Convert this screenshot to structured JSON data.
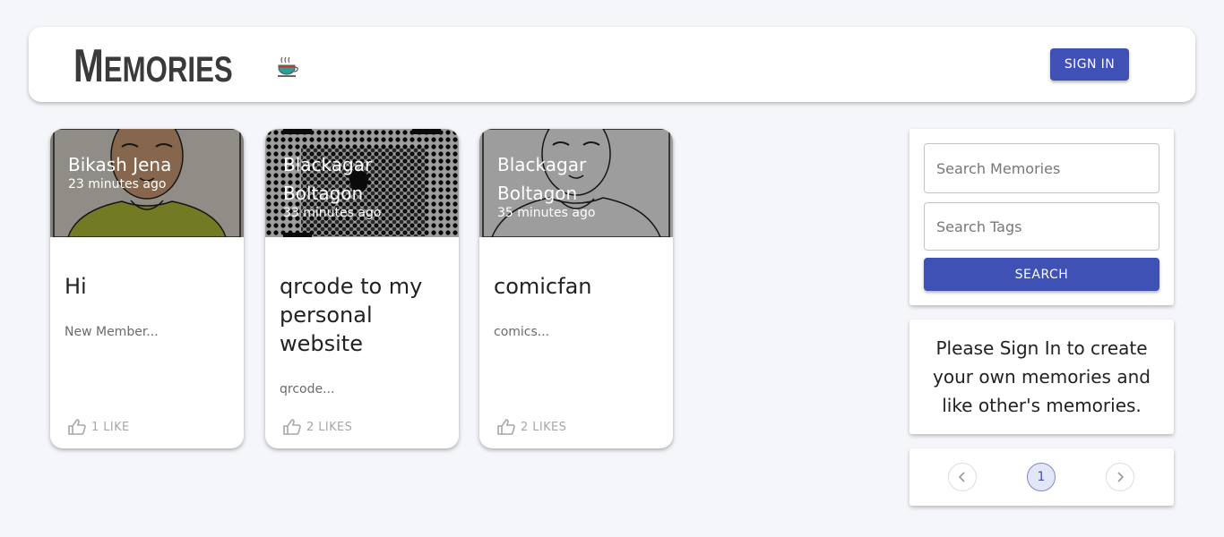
{
  "header": {
    "brand_first": "M",
    "brand_rest": "EMORIES",
    "sign_in_label": "SIGN IN"
  },
  "posts": [
    {
      "creator": "Bikash Jena",
      "time": "23 minutes ago",
      "title": "Hi",
      "message": "New Member...",
      "likes": "1 LIKE"
    },
    {
      "creator": "Blackagar Boltagon",
      "time": "33 minutes ago",
      "title": "qrcode to my personal website",
      "message": "qrcode...",
      "likes": "2 LIKES"
    },
    {
      "creator": "Blackagar Boltagon",
      "time": "35 minutes ago",
      "title": "comicfan",
      "message": "comics...",
      "likes": "2 LIKES"
    }
  ],
  "search": {
    "memories_placeholder": "Search Memories",
    "tags_placeholder": "Search Tags",
    "button_label": "SEARCH"
  },
  "info": {
    "text": "Please Sign In to create your own memories and like other's memories."
  },
  "pagination": {
    "current_page": "1",
    "prev_icon": "chevron-left-icon",
    "next_icon": "chevron-right-icon"
  },
  "colors": {
    "primary": "#3f51b5",
    "background": "#f5f6fa"
  }
}
